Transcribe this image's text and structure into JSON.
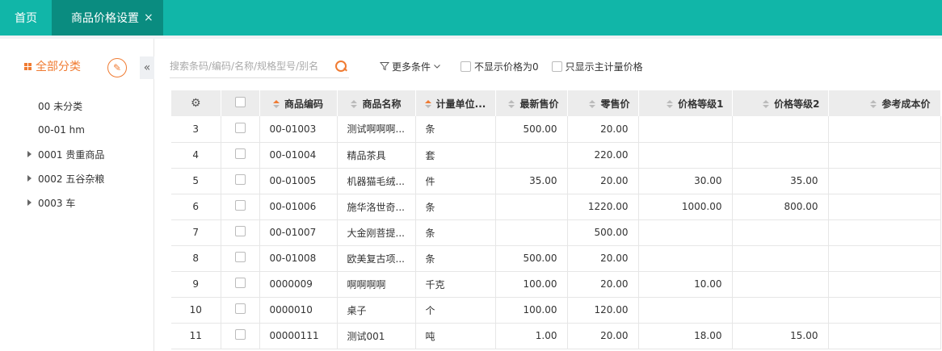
{
  "tabs": [
    {
      "label": "首页"
    },
    {
      "label": "商品价格设置",
      "close": "×"
    }
  ],
  "sidebar": {
    "title": "全部分类",
    "collapse_glyph": "«",
    "edit_glyph": "✎",
    "items": [
      {
        "label": "00 未分类"
      },
      {
        "label": "00-01 hm"
      },
      {
        "label": "0001 贵重商品"
      },
      {
        "label": "0002 五谷杂粮"
      },
      {
        "label": "0003 车"
      }
    ]
  },
  "toolbar": {
    "search_placeholder": "搜索条码/编码/名称/规格型号/别名",
    "more_conditions": "更多条件",
    "hide_zero_price": "不显示价格为0",
    "only_main_unit": "只显示主计量价格"
  },
  "table": {
    "settings_glyph": "⚙",
    "columns": [
      "商品编码",
      "商品名称",
      "计量单位...",
      "最新售价",
      "零售价",
      "价格等级1",
      "价格等级2",
      "参考成本价"
    ],
    "rows": [
      {
        "idx": "3",
        "code": "00-01003",
        "name": "测试啊啊啊...",
        "unit": "条",
        "latest": "500.00",
        "retail": "20.00",
        "lv1": "",
        "lv2": "",
        "cost": ""
      },
      {
        "idx": "4",
        "code": "00-01004",
        "name": "精品茶具",
        "unit": "套",
        "latest": "",
        "retail": "220.00",
        "lv1": "",
        "lv2": "",
        "cost": ""
      },
      {
        "idx": "5",
        "code": "00-01005",
        "name": "机器猫毛绒...",
        "unit": "件",
        "latest": "35.00",
        "retail": "20.00",
        "lv1": "30.00",
        "lv2": "35.00",
        "cost": ""
      },
      {
        "idx": "6",
        "code": "00-01006",
        "name": "施华洛世奇...",
        "unit": "条",
        "latest": "",
        "retail": "1220.00",
        "lv1": "1000.00",
        "lv2": "800.00",
        "cost": ""
      },
      {
        "idx": "7",
        "code": "00-01007",
        "name": "大金刚菩提...",
        "unit": "条",
        "latest": "",
        "retail": "500.00",
        "lv1": "",
        "lv2": "",
        "cost": ""
      },
      {
        "idx": "8",
        "code": "00-01008",
        "name": "欧美复古项...",
        "unit": "条",
        "latest": "500.00",
        "retail": "20.00",
        "lv1": "",
        "lv2": "",
        "cost": ""
      },
      {
        "idx": "9",
        "code": "0000009",
        "name": "啊啊啊啊",
        "unit": "千克",
        "latest": "100.00",
        "retail": "20.00",
        "lv1": "10.00",
        "lv2": "",
        "cost": ""
      },
      {
        "idx": "10",
        "code": "0000010",
        "name": "桌子",
        "unit": "个",
        "latest": "100.00",
        "retail": "120.00",
        "lv1": "",
        "lv2": "",
        "cost": ""
      },
      {
        "idx": "11",
        "code": "00000111",
        "name": "测试001",
        "unit": "吨",
        "latest": "1.00",
        "retail": "20.00",
        "lv1": "18.00",
        "lv2": "15.00",
        "cost": ""
      }
    ]
  },
  "colors": {
    "brand": "#11b6a8",
    "brand_dark": "#0a8c80",
    "accent": "#f07b32"
  }
}
